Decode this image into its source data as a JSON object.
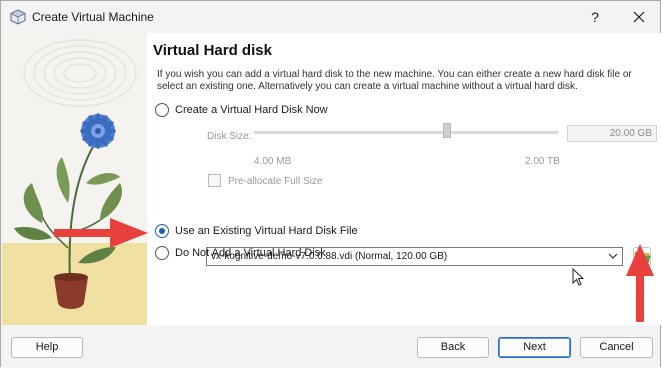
{
  "window": {
    "title": "Create Virtual Machine",
    "help_glyph": "?",
    "close_glyph": "✕"
  },
  "page": {
    "heading": "Virtual Hard disk",
    "description": "If you wish you can add a virtual hard disk to the new machine. You can either create a new hard disk file or select an existing one. Alternatively you can create a virtual machine without a virtual hard disk."
  },
  "options": {
    "create_new_label": "Create a Virtual Hard Disk Now",
    "use_existing_label": "Use an Existing Virtual Hard Disk File",
    "no_disk_label": "Do Not Add a Virtual Hard Disk",
    "selected": "use_existing"
  },
  "disk_size": {
    "label": "Disk Size:",
    "min_label": "4.00 MB",
    "max_label": "2.00 TB",
    "value": "20.00 GB",
    "preallocate_label": "Pre-allocate Full Size"
  },
  "existing_disk": {
    "selected_file": "vx-kognitive-demo-v7.0.0.88.vdi (Normal, 120.00 GB)"
  },
  "buttons": {
    "help": "Help",
    "back": "Back",
    "next": "Next",
    "cancel": "Cancel"
  },
  "colors": {
    "accent": "#1a5fb4",
    "annotation_arrow": "#e8403a"
  }
}
